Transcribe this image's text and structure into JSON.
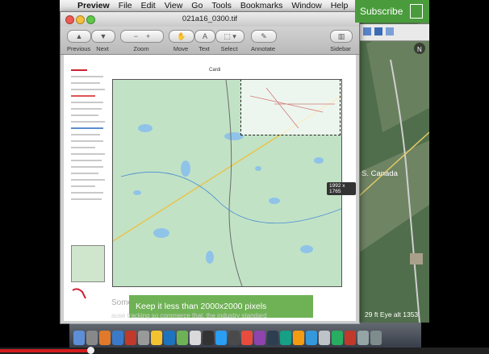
{
  "menubar": {
    "apple_glyph": "",
    "items": [
      "Preview",
      "File",
      "Edit",
      "View",
      "Go",
      "Tools",
      "Bookmarks",
      "Window",
      "Help"
    ]
  },
  "window": {
    "title": "021a16_0300.tif",
    "toolbar": [
      {
        "label": "Previous"
      },
      {
        "label": "Next"
      },
      {
        "label": "Zoom"
      },
      {
        "label": "Move"
      },
      {
        "label": "Text"
      },
      {
        "label": "Select"
      },
      {
        "label": "Annotate"
      },
      {
        "label": "Sidebar"
      }
    ]
  },
  "map": {
    "title": "Cardi",
    "size_tooltip": "1992 x 1765"
  },
  "youtube": {
    "subscribe_label": "Subscribe",
    "notice_main": "Keep it less than 2000x2000 pixels",
    "notice_behind": "Some Web Ads",
    "notice_sub": "ause tracking so commerce that, the industry standard",
    "earth_label": "S. Canada",
    "elevation": "29 ft  Eye alt   1353",
    "progress_fraction": 0.185
  }
}
